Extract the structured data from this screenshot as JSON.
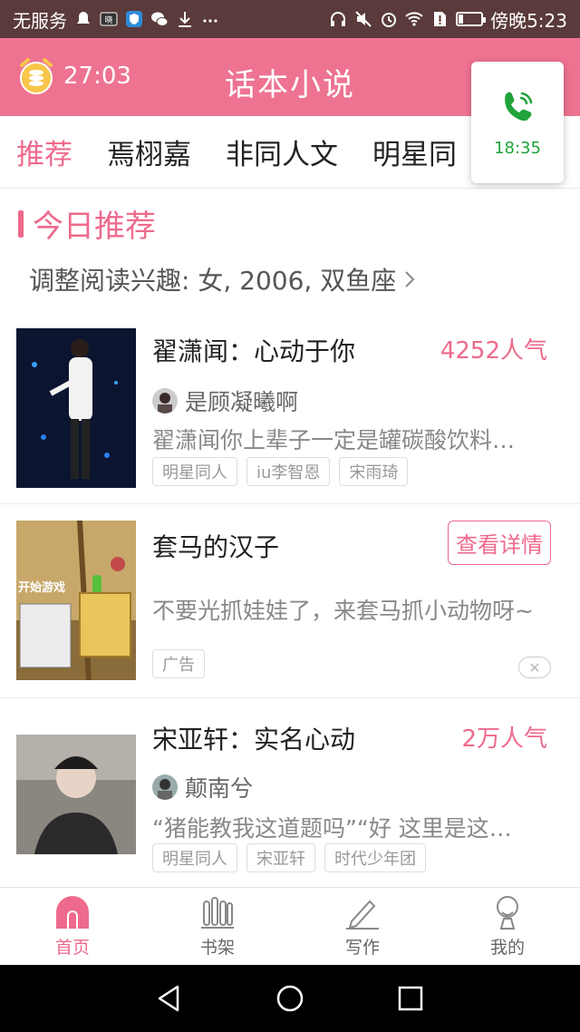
{
  "status_bar": {
    "carrier": "无服务",
    "time": "傍晚5:23",
    "battery_level": 0.18
  },
  "app": {
    "timer": "27:03",
    "title": "话本小说"
  },
  "call_bubble": {
    "time": "18:35",
    "color": "#1fa33a"
  },
  "tabs": [
    {
      "label": "推荐",
      "active": true
    },
    {
      "label": "焉栩嘉"
    },
    {
      "label": "非同人文"
    },
    {
      "label": "明星同"
    }
  ],
  "section": {
    "title": "今日推荐",
    "interest_text": "调整阅读兴趣: 女, 2006, 双鱼座"
  },
  "items": [
    {
      "title": "翟潇闻：心动于你",
      "popularity": "4252人气",
      "author": "是顾凝曦啊",
      "desc": "翟潇闻你上辈子一定是罐碳酸饮料…",
      "tags": [
        "明星同人",
        "iu李智恩",
        "宋雨琦"
      ]
    },
    {
      "title": "套马的汉子",
      "button": "查看详情",
      "desc": "不要光抓娃娃了，来套马抓小动物呀~",
      "ad_label": "广告",
      "cover_text": "开始游戏"
    },
    {
      "title": "宋亚轩：实名心动",
      "popularity": "2万人气",
      "author": "颠南兮",
      "desc": "“猪能教我这道题吗”“好 这里是这…",
      "tags": [
        "明星同人",
        "宋亚轩",
        "时代少年团"
      ]
    }
  ],
  "bottom_nav": [
    {
      "label": "首页",
      "icon": "home-icon",
      "active": true
    },
    {
      "label": "书架",
      "icon": "bookshelf-icon"
    },
    {
      "label": "写作",
      "icon": "pen-icon"
    },
    {
      "label": "我的",
      "icon": "profile-icon"
    }
  ],
  "colors": {
    "accent": "#ee6a8c",
    "header": "#ee7391",
    "status_bar": "#5a3a3a"
  }
}
